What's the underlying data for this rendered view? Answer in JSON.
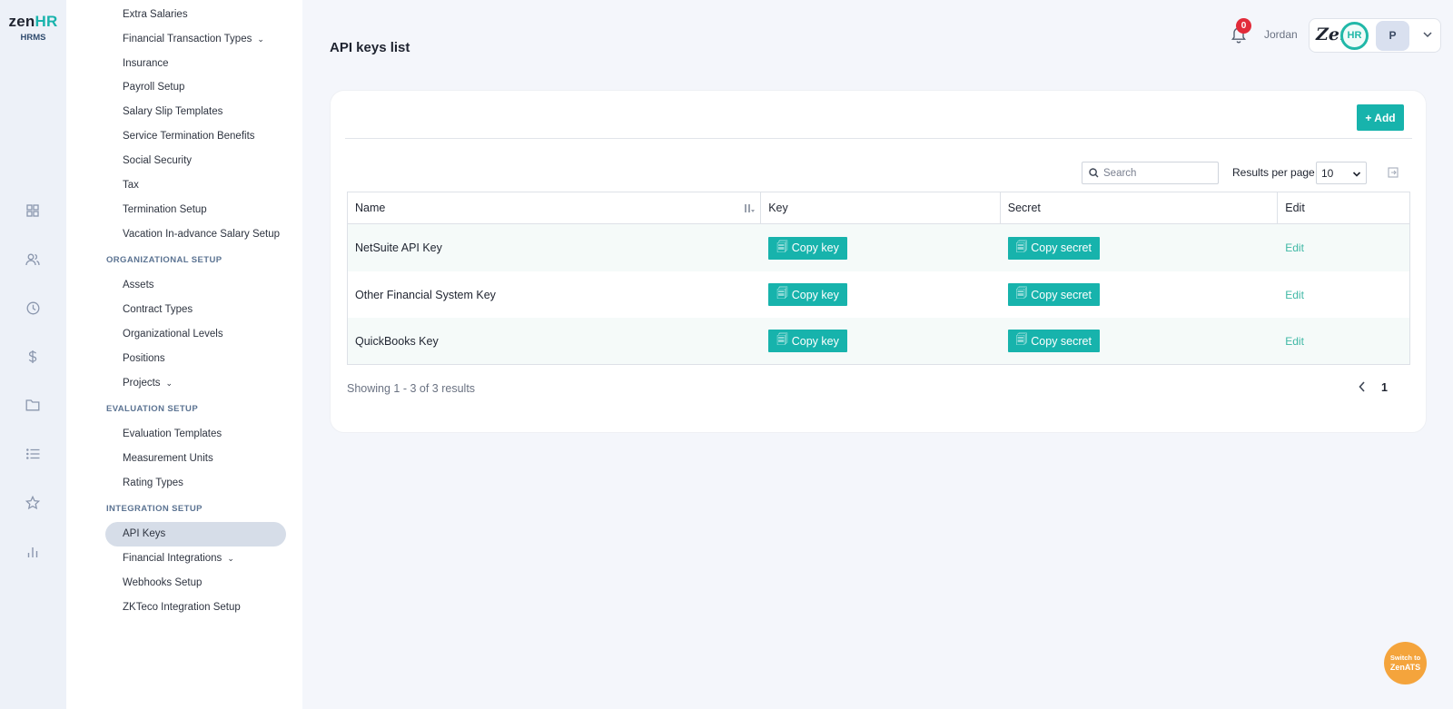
{
  "brand": {
    "logo_part1": "zen",
    "logo_part2": "HR",
    "product": "HRMS"
  },
  "rail": {
    "icons": [
      "dashboard-icon",
      "people-icon",
      "clock-icon",
      "dollar-icon",
      "folder-icon",
      "list-icon",
      "star-icon",
      "bar-chart-icon"
    ]
  },
  "nav": {
    "items_top": [
      {
        "label": "Extra Salaries",
        "chevron": false
      },
      {
        "label": "Financial Transaction Types",
        "chevron": true
      },
      {
        "label": "Insurance",
        "chevron": false
      },
      {
        "label": "Payroll Setup",
        "chevron": false
      },
      {
        "label": "Salary Slip Templates",
        "chevron": false
      },
      {
        "label": "Service Termination Benefits",
        "chevron": false
      },
      {
        "label": "Social Security",
        "chevron": false
      },
      {
        "label": "Tax",
        "chevron": false
      },
      {
        "label": "Termination Setup",
        "chevron": false
      },
      {
        "label": "Vacation In-advance Salary Setup",
        "chevron": false
      }
    ],
    "section_org": "ORGANIZATIONAL SETUP",
    "items_org": [
      {
        "label": "Assets",
        "chevron": false
      },
      {
        "label": "Contract Types",
        "chevron": false
      },
      {
        "label": "Organizational Levels",
        "chevron": false
      },
      {
        "label": "Positions",
        "chevron": false
      },
      {
        "label": "Projects",
        "chevron": true
      }
    ],
    "section_eval": "EVALUATION SETUP",
    "items_eval": [
      {
        "label": "Evaluation Templates",
        "chevron": false
      },
      {
        "label": "Measurement Units",
        "chevron": false
      },
      {
        "label": "Rating Types",
        "chevron": false
      }
    ],
    "section_integration": "INTEGRATION SETUP",
    "items_integration": [
      {
        "label": "API Keys",
        "chevron": false,
        "active": true
      },
      {
        "label": "Financial Integrations",
        "chevron": true
      },
      {
        "label": "Webhooks Setup",
        "chevron": false
      },
      {
        "label": "ZKTeco Integration Setup",
        "chevron": false
      }
    ]
  },
  "header": {
    "title": "API keys list",
    "notification_count": "0",
    "user_name": "Jordan",
    "account_logo": "Zen",
    "account_logo_ring": "HR",
    "avatar_initial": "P"
  },
  "toolbar": {
    "add_label": "+ Add",
    "search_placeholder": "Search",
    "results_per_page_label": "Results per page",
    "results_per_page_value": "10"
  },
  "table": {
    "columns": [
      "Name",
      "Key",
      "Secret",
      "Edit"
    ],
    "copy_key_label": "Copy key",
    "copy_secret_label": "Copy secret",
    "edit_label": "Edit",
    "rows": [
      {
        "name": "NetSuite API Key"
      },
      {
        "name": "Other Financial System Key"
      },
      {
        "name": "QuickBooks Key"
      }
    ]
  },
  "footer": {
    "showing": "Showing 1 - 3 of 3 results",
    "current_page": "1"
  },
  "switch": {
    "line1": "Switch to",
    "line2": "ZenATS"
  },
  "colors": {
    "accent": "#17b3ac",
    "badge": "#e22b3a",
    "switch": "#f4a43c"
  }
}
